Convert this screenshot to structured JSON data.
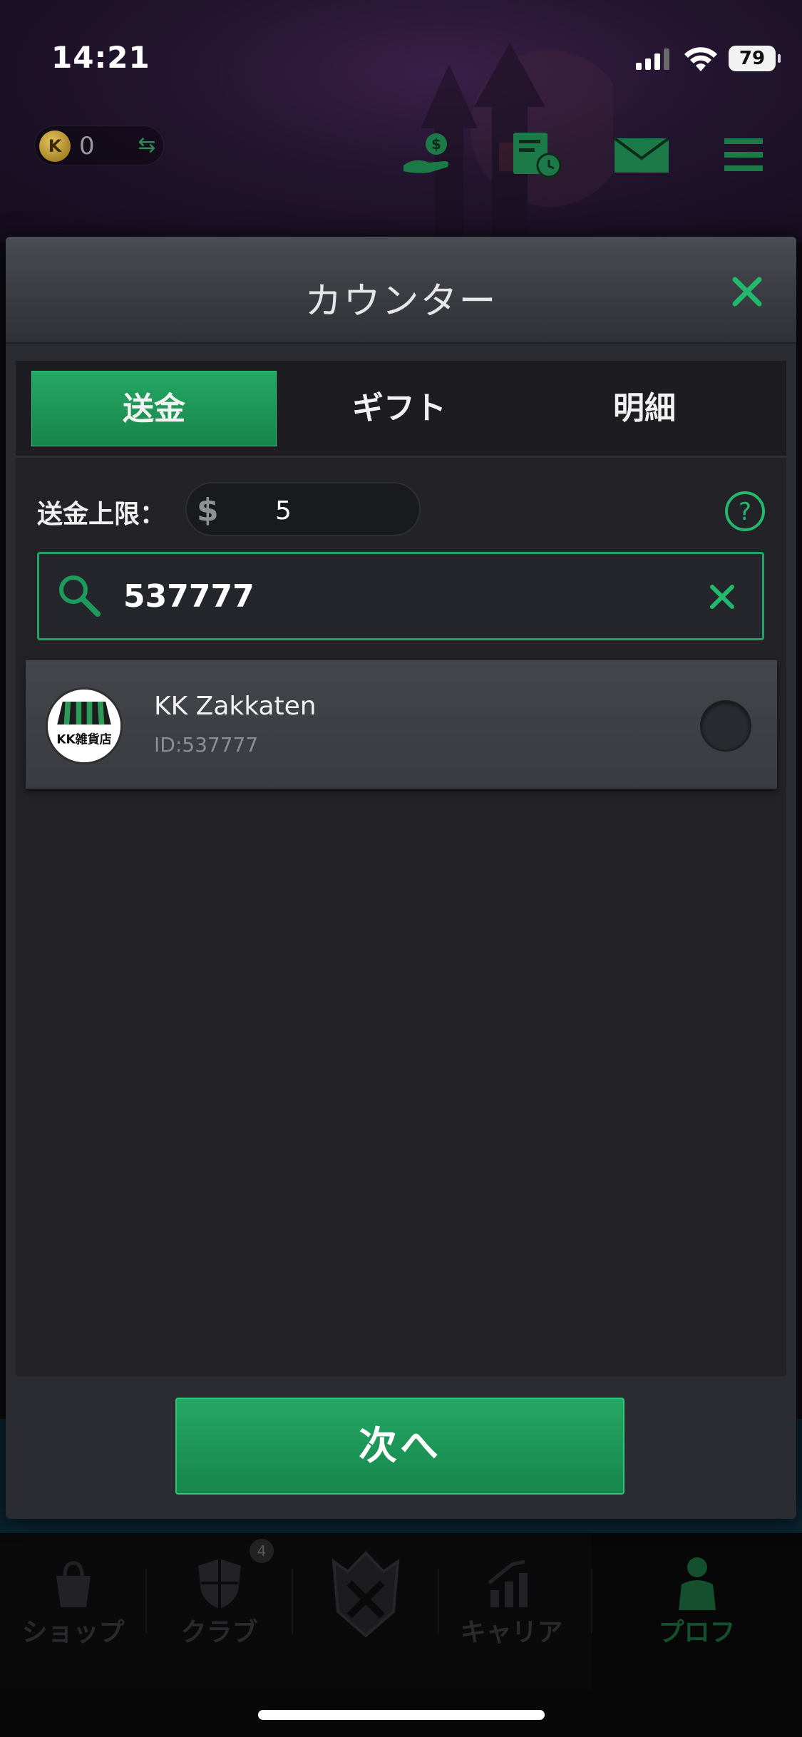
{
  "status_bar": {
    "time": "14:21",
    "battery": "79"
  },
  "top_bar": {
    "coin_letter": "K",
    "coin_balance": "0",
    "icons": [
      "hand-money-icon",
      "history-clock-icon",
      "mail-icon",
      "menu-icon"
    ]
  },
  "modal": {
    "title": "カウンター",
    "tabs": [
      {
        "label": "送金",
        "active": true
      },
      {
        "label": "ギフト",
        "active": false
      },
      {
        "label": "明細",
        "active": false
      }
    ],
    "limit": {
      "label": "送金上限：",
      "currency_symbol": "$",
      "value": "5"
    },
    "search": {
      "value": "537777"
    },
    "results": [
      {
        "name": "KK Zakkaten",
        "id": "ID:537777",
        "avatar_text": "KK雑貨店",
        "selected": false
      }
    ],
    "next_label": "次へ"
  },
  "bottom_nav": {
    "items": [
      {
        "label": "ショップ",
        "icon": "shopping-bag-icon"
      },
      {
        "label": "クラブ",
        "icon": "club-shield-icon",
        "badge": "4"
      },
      {
        "label": "",
        "icon": "kk-emblem-icon"
      },
      {
        "label": "キャリア",
        "icon": "career-chart-icon"
      },
      {
        "label": "プロフ",
        "icon": "profile-person-icon",
        "active": true
      }
    ]
  },
  "colors": {
    "accent_green": "#1fa463",
    "modal_bg": "#2b2c31",
    "panel_bg": "#222227"
  }
}
